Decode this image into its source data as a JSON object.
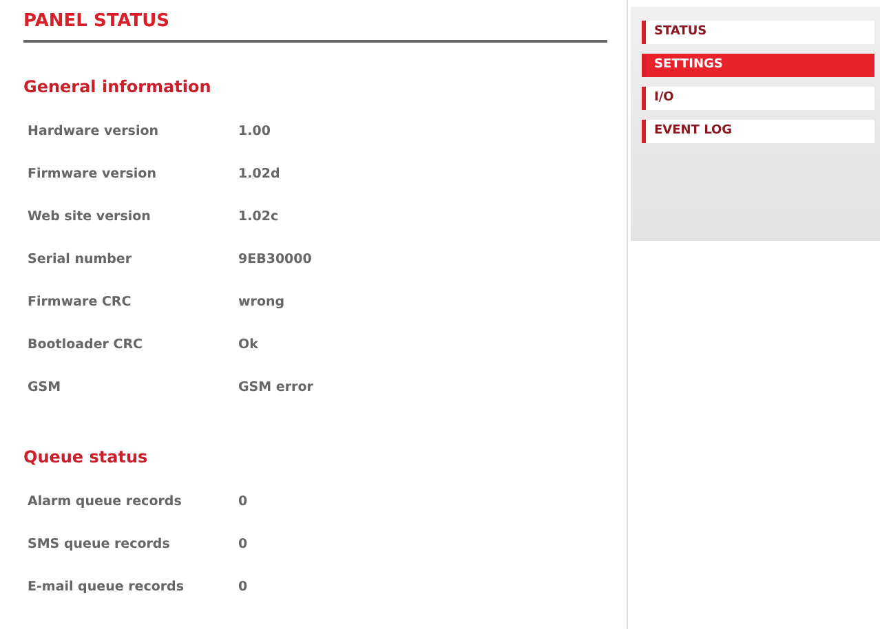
{
  "page_title": "PANEL STATUS",
  "sections": [
    {
      "title": "General information",
      "rows": [
        {
          "label": "Hardware version",
          "value": "1.00"
        },
        {
          "label": "Firmware version",
          "value": "1.02d"
        },
        {
          "label": "Web site version",
          "value": "1.02c"
        },
        {
          "label": "Serial number",
          "value": "9EB30000"
        },
        {
          "label": "Firmware CRC",
          "value": "wrong"
        },
        {
          "label": "Bootloader CRC",
          "value": "Ok"
        },
        {
          "label": "GSM",
          "value": "GSM error"
        }
      ]
    },
    {
      "title": "Queue status",
      "rows": [
        {
          "label": "Alarm queue records",
          "value": "0"
        },
        {
          "label": "SMS queue records",
          "value": "0"
        },
        {
          "label": "E-mail queue records",
          "value": "0"
        }
      ]
    }
  ],
  "menu": [
    {
      "label": "STATUS",
      "selected": false
    },
    {
      "label": "SETTINGS",
      "selected": true
    },
    {
      "label": "I/O",
      "selected": false
    },
    {
      "label": "EVENT LOG",
      "selected": false
    }
  ]
}
